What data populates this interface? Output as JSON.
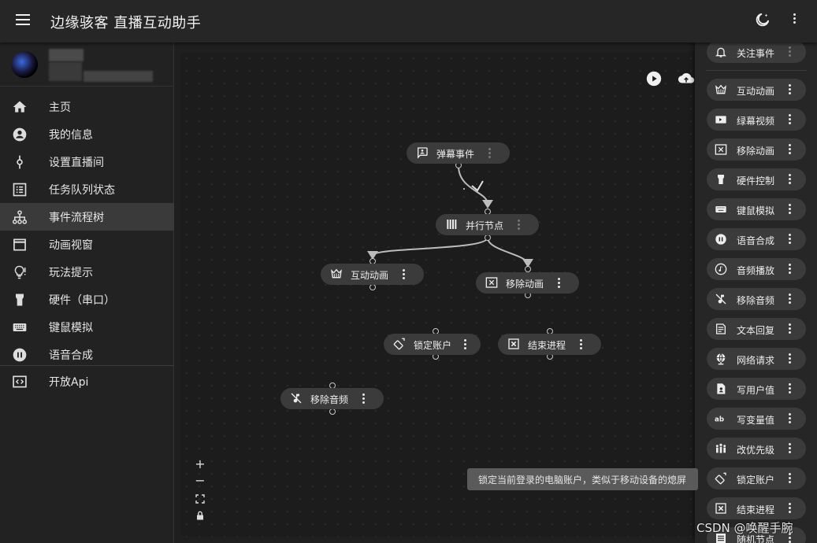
{
  "app": {
    "title": "边缘骇客 直播互动助手"
  },
  "icons": {
    "menu": "hamburger-icon",
    "theme": "dark-mode-icon",
    "more": "more-vert-icon",
    "run": "play-circle-icon",
    "upload": "cloud-upload-icon",
    "zoom_in": "plus-icon",
    "zoom_out": "minus-icon",
    "fit": "fit-view-icon",
    "lock": "lock-icon"
  },
  "sidebar": {
    "items": [
      {
        "label": "主页",
        "icon": "home-icon"
      },
      {
        "label": "我的信息",
        "icon": "account-circle-icon"
      },
      {
        "label": "设置直播间",
        "icon": "commit-icon"
      },
      {
        "label": "任务队列状态",
        "icon": "list-alt-icon"
      },
      {
        "label": "事件流程树",
        "icon": "account-tree-icon",
        "active": true
      },
      {
        "label": "动画视窗",
        "icon": "window-icon"
      },
      {
        "label": "玩法提示",
        "icon": "lightbulb-icon"
      },
      {
        "label": "硬件（串口）",
        "icon": "hardware-icon"
      },
      {
        "label": "键鼠模拟",
        "icon": "keyboard-icon"
      },
      {
        "label": "语音合成",
        "icon": "pause-circle-icon"
      },
      {
        "label": "开放Api",
        "icon": "code-icon"
      }
    ]
  },
  "flow": {
    "nodes": [
      {
        "label": "弹幕事件",
        "icon": "comment-icon"
      },
      {
        "label": "并行节点",
        "icon": "parallel-bars-icon"
      },
      {
        "label": "互动动画",
        "icon": "crown-icon"
      },
      {
        "label": "移除动画",
        "icon": "remove-animation-icon"
      },
      {
        "label": "锁定账户",
        "icon": "screen-lock-rotation-icon"
      },
      {
        "label": "结束进程",
        "icon": "close-box-icon"
      },
      {
        "label": "移除音频",
        "icon": "music-off-icon"
      }
    ]
  },
  "palette": {
    "items": [
      {
        "label": "关注事件",
        "icon": "bell-add-icon"
      },
      {
        "label": "互动动画",
        "icon": "crown-icon"
      },
      {
        "label": "绿幕视频",
        "icon": "videocam-icon"
      },
      {
        "label": "移除动画",
        "icon": "remove-animation-icon"
      },
      {
        "label": "硬件控制",
        "icon": "hardware-icon"
      },
      {
        "label": "键鼠模拟",
        "icon": "keyboard-icon"
      },
      {
        "label": "语音合成",
        "icon": "pause-circle-icon"
      },
      {
        "label": "音频播放",
        "icon": "music-note-icon"
      },
      {
        "label": "移除音频",
        "icon": "music-off-icon"
      },
      {
        "label": "文本回复",
        "icon": "text-snippet-icon"
      },
      {
        "label": "网络请求",
        "icon": "globe-icon"
      },
      {
        "label": "写用户值",
        "icon": "person-file-icon"
      },
      {
        "label": "写变量值",
        "icon": "abc-icon"
      },
      {
        "label": "改优先级",
        "icon": "groups-icon"
      },
      {
        "label": "锁定账户",
        "icon": "screen-lock-rotation-icon"
      },
      {
        "label": "结束进程",
        "icon": "close-box-icon"
      },
      {
        "label": "随机节点",
        "icon": "list-icon"
      }
    ]
  },
  "tooltip": "锁定当前登录的电脑账户，类似于移动设备的熄屏",
  "watermark": "CSDN @唤醒手腕"
}
